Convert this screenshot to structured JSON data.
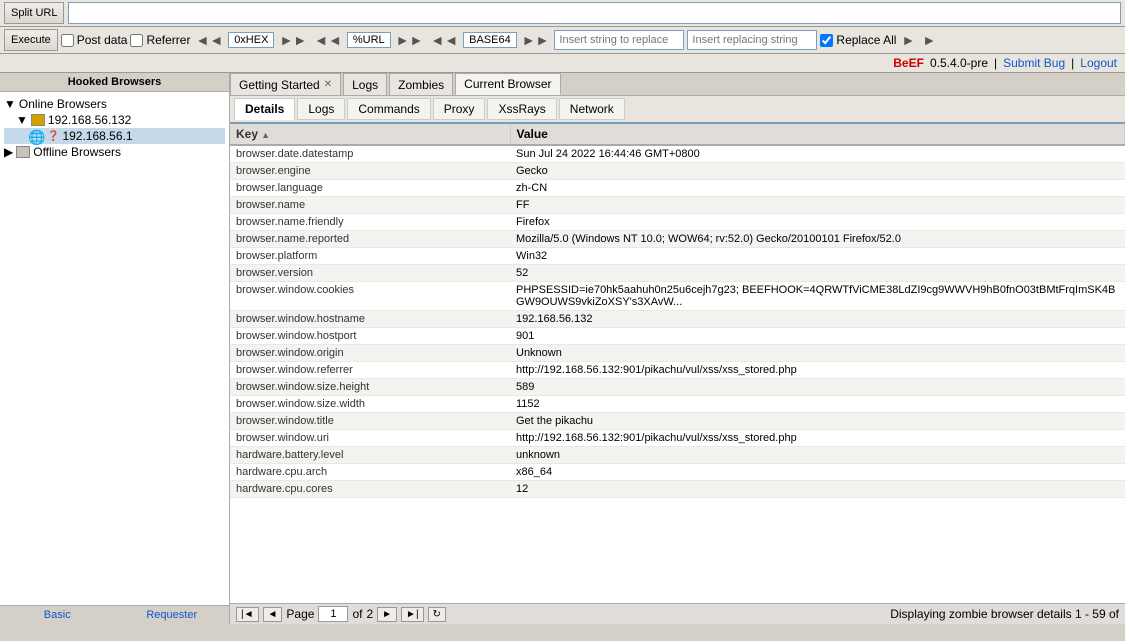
{
  "toolbar": {
    "split_url_label": "Split URL",
    "execute_label": "Execute",
    "post_data_label": "Post data",
    "referrer_label": "Referrer",
    "oxhex_label": "0xHEX",
    "percent_url_label": "%URL",
    "base64_label": "BASE64",
    "insert_replace_label": "Insert string to replace",
    "insert_replacing_label": "Insert replacing string",
    "replace_all_label": "Replace All"
  },
  "beef_bar": {
    "logo": "BeEF",
    "version": "0.5.4.0-pre",
    "submit_bug": "Submit Bug",
    "logout": "Logout"
  },
  "sidebar": {
    "title": "Hooked Browsers",
    "online_label": "Online Browsers",
    "ip_group": "192.168.56.132",
    "ip_item": "192.168.56.1",
    "offline_label": "Offline Browsers",
    "footer_basic": "Basic",
    "footer_requester": "Requester"
  },
  "tabs_outer": [
    {
      "label": "Getting Started",
      "closable": true
    },
    {
      "label": "Logs",
      "closable": false
    },
    {
      "label": "Zombies",
      "closable": false
    },
    {
      "label": "Current Browser",
      "closable": false,
      "active": true
    }
  ],
  "tabs_inner": [
    {
      "label": "Details",
      "active": true
    },
    {
      "label": "Logs"
    },
    {
      "label": "Commands"
    },
    {
      "label": "Proxy"
    },
    {
      "label": "XssRays"
    },
    {
      "label": "Network"
    }
  ],
  "table": {
    "col_key": "Key",
    "col_value": "Value",
    "rows": [
      {
        "key": "browser.date.datestamp",
        "value": "Sun Jul 24 2022 16:44:46 GMT+0800"
      },
      {
        "key": "browser.engine",
        "value": "Gecko"
      },
      {
        "key": "browser.language",
        "value": "zh-CN"
      },
      {
        "key": "browser.name",
        "value": "FF"
      },
      {
        "key": "browser.name.friendly",
        "value": "Firefox"
      },
      {
        "key": "browser.name.reported",
        "value": "Mozilla/5.0 (Windows NT 10.0; WOW64; rv:52.0) Gecko/20100101 Firefox/52.0"
      },
      {
        "key": "browser.platform",
        "value": "Win32"
      },
      {
        "key": "browser.version",
        "value": "52"
      },
      {
        "key": "browser.window.cookies",
        "value": "PHPSESSID=ie70hk5aahuh0n25u6cejh7g23; BEEFHOOK=4QRWTfViCME38LdZI9cg9WWVH9hB0fnO03tBMtFrqImSK4BGW9OUWS9vkiZoXSY's3XAvW..."
      },
      {
        "key": "browser.window.hostname",
        "value": "192.168.56.132"
      },
      {
        "key": "browser.window.hostport",
        "value": "901"
      },
      {
        "key": "browser.window.origin",
        "value": "Unknown"
      },
      {
        "key": "browser.window.referrer",
        "value": "http://192.168.56.132:901/pikachu/vul/xss/xss_stored.php"
      },
      {
        "key": "browser.window.size.height",
        "value": "589"
      },
      {
        "key": "browser.window.size.width",
        "value": "1152"
      },
      {
        "key": "browser.window.title",
        "value": "Get the pikachu"
      },
      {
        "key": "browser.window.uri",
        "value": "http://192.168.56.132:901/pikachu/vul/xss/xss_stored.php"
      },
      {
        "key": "hardware.battery.level",
        "value": "unknown"
      },
      {
        "key": "hardware.cpu.arch",
        "value": "x86_64"
      },
      {
        "key": "hardware.cpu.cores",
        "value": "12"
      }
    ]
  },
  "table_footer": {
    "displaying": "Displaying zombie browser details 1 - 59 of",
    "page_of": "of",
    "page_num": "1",
    "total_pages": "2"
  }
}
